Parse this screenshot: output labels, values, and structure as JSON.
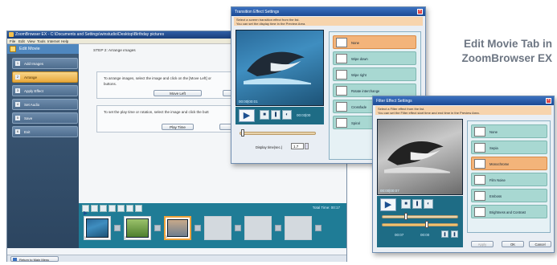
{
  "caption": {
    "line1": "Edit Movie Tab in",
    "line2": "ZoomBrowser EX"
  },
  "main_window": {
    "title": "ZoomBrowser EX - C:\\Documents and Settings\\winstudio\\Desktop\\Birthday pictures",
    "menu": [
      "File",
      "Edit",
      "View",
      "Tools",
      "Internet",
      "Help"
    ],
    "sidebar": {
      "header": "Edit Movie",
      "items": [
        {
          "num": "1",
          "label": "Add Images"
        },
        {
          "num": "2",
          "label": "Arrange",
          "active": true
        },
        {
          "num": "3",
          "label": "Apply Effect"
        },
        {
          "num": "4",
          "label": "Set Audio"
        },
        {
          "num": "5",
          "label": "Save"
        },
        {
          "num": "6",
          "label": "Exit"
        }
      ]
    },
    "step_title": "STEP 2: Arrange images",
    "arrange_text_1": "To arrange images, select the image and click on the [Move Left] or",
    "arrange_text_2": "buttons.",
    "move_left_label": "Move Left",
    "play_time_text": "To set the play time or rotation, select the image and click the butt",
    "play_time_label": "Play Time",
    "total_time_label": "Total Time:",
    "total_time_value": "00:17",
    "thumbs": [
      "1",
      "2",
      "3"
    ],
    "return_label": "Return to Main Menu"
  },
  "transition_dialog": {
    "title": "Transition Effect Settings",
    "inst_1": "Select a screen transition effect from the list.",
    "inst_2": "You can set the display time in the Preview Area.",
    "timecode": "00:00|00:01",
    "end_time": "00:03|00",
    "display_time_label": "Display time(sec.)",
    "display_time_value": "1.7",
    "effects": [
      {
        "label": "None",
        "selected": true
      },
      {
        "label": "Wipe down"
      },
      {
        "label": "Wipe right"
      },
      {
        "label": "Rotate interchange"
      },
      {
        "label": "Crossfade"
      },
      {
        "label": "Spiral"
      }
    ]
  },
  "filter_dialog": {
    "title": "Filter Effect Settings",
    "inst_1": "Select a Filter effect from the list.",
    "inst_2": "You can set the Filter effect start time and end time in the Preview Area.",
    "timecode": "00:00|00:07",
    "start_time": "00:07",
    "end_time": "00:00",
    "filters": [
      {
        "label": "None"
      },
      {
        "label": "Sepia"
      },
      {
        "label": "Monochrome",
        "selected": true
      },
      {
        "label": "Film Noise"
      },
      {
        "label": "Emboss"
      },
      {
        "label": "Brightness and Contrast"
      }
    ],
    "buttons": {
      "apply": "Apply",
      "ok": "OK",
      "cancel": "Cancel"
    }
  }
}
